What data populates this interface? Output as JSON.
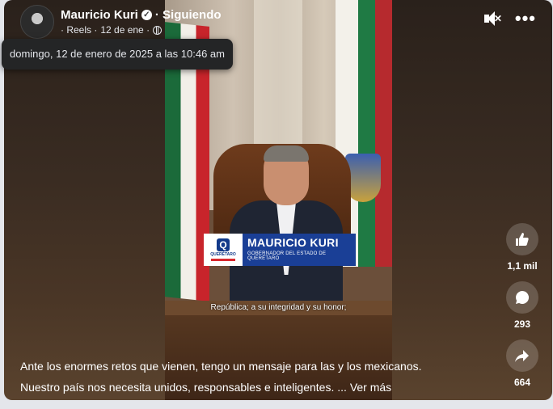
{
  "header": {
    "author": "Mauricio Kuri",
    "follow_status": "· Siguiendo",
    "meta_type": "· Reels ·",
    "meta_date": "12 de ene ·"
  },
  "tooltip": {
    "text": "domingo, 12 de enero de 2025 a las 10:46 am"
  },
  "video": {
    "lower_third_name": "MAURICIO KURI",
    "lower_third_title": "GOBERNADOR DEL ESTADO DE QUERÉTARO",
    "logo_text": "QUERÉTARO",
    "subtitle": "República; a su integridad y su honor;"
  },
  "actions": {
    "likes": "1,1 mil",
    "comments": "293",
    "shares": "664"
  },
  "caption": {
    "line1": "Ante los enormes retos que vienen, tengo un mensaje para las y los mexicanos.",
    "line2": "Nuestro país nos necesita unidos, responsables e inteligentes. ...",
    "see_more": "Ver más"
  },
  "icons": [
    "verified-icon",
    "globe-icon",
    "mute-icon",
    "more-icon",
    "like-icon",
    "comment-icon",
    "share-icon"
  ],
  "colors": {
    "lower_third_blue": "#1a3f96",
    "background": "#e4e6eb"
  }
}
